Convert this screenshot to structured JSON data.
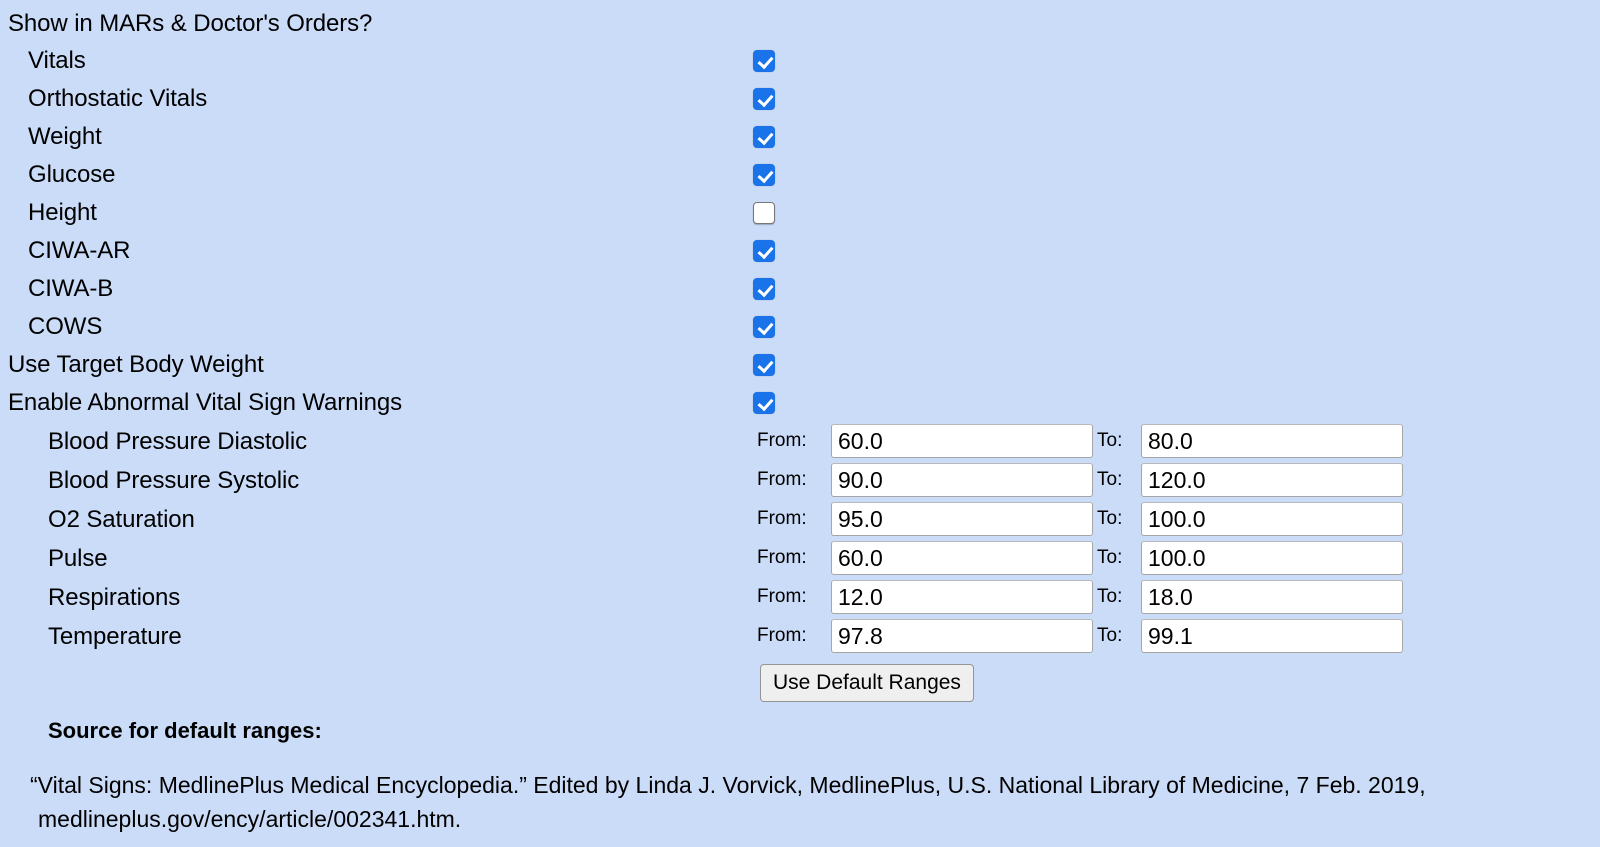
{
  "colors": {
    "background": "#cbdcf8",
    "checkbox_checked": "#1a73e8",
    "checkbox_unchecked_border": "#767676",
    "input_background": "#ffffff",
    "input_border": "#a6a6a6",
    "button_background": "#efefef"
  },
  "heading": {
    "text": "Show in MARs & Doctor's Orders?"
  },
  "show_items": [
    {
      "label": "Vitals",
      "checked": true
    },
    {
      "label": "Orthostatic Vitals",
      "checked": true
    },
    {
      "label": "Weight",
      "checked": true
    },
    {
      "label": "Glucose",
      "checked": true
    },
    {
      "label": "Height",
      "checked": false
    },
    {
      "label": "CIWA-AR",
      "checked": true
    },
    {
      "label": "CIWA-B",
      "checked": true
    },
    {
      "label": "COWS",
      "checked": true
    }
  ],
  "top_level_options": [
    {
      "label": "Use Target Body Weight",
      "checked": true
    },
    {
      "label": "Enable Abnormal Vital Sign Warnings",
      "checked": true
    }
  ],
  "range_labels": {
    "from": "From:",
    "to": "To:"
  },
  "vital_ranges": [
    {
      "label": "Blood Pressure Diastolic",
      "from": "60.0",
      "to": "80.0"
    },
    {
      "label": "Blood Pressure Systolic",
      "from": "90.0",
      "to": "120.0"
    },
    {
      "label": "O2 Saturation",
      "from": "95.0",
      "to": "100.0"
    },
    {
      "label": "Pulse",
      "from": "60.0",
      "to": "100.0"
    },
    {
      "label": "Respirations",
      "from": "12.0",
      "to": "18.0"
    },
    {
      "label": "Temperature",
      "from": "97.8",
      "to": "99.1"
    }
  ],
  "default_button": {
    "label": "Use Default Ranges"
  },
  "source": {
    "title": "Source for default ranges:",
    "citation_line1": "“Vital Signs: MedlinePlus Medical Encyclopedia.” Edited by Linda J. Vorvick, MedlinePlus, U.S. National Library of Medicine, 7 Feb. 2019,",
    "citation_line2": "medlineplus.gov/ency/article/002341.htm."
  }
}
